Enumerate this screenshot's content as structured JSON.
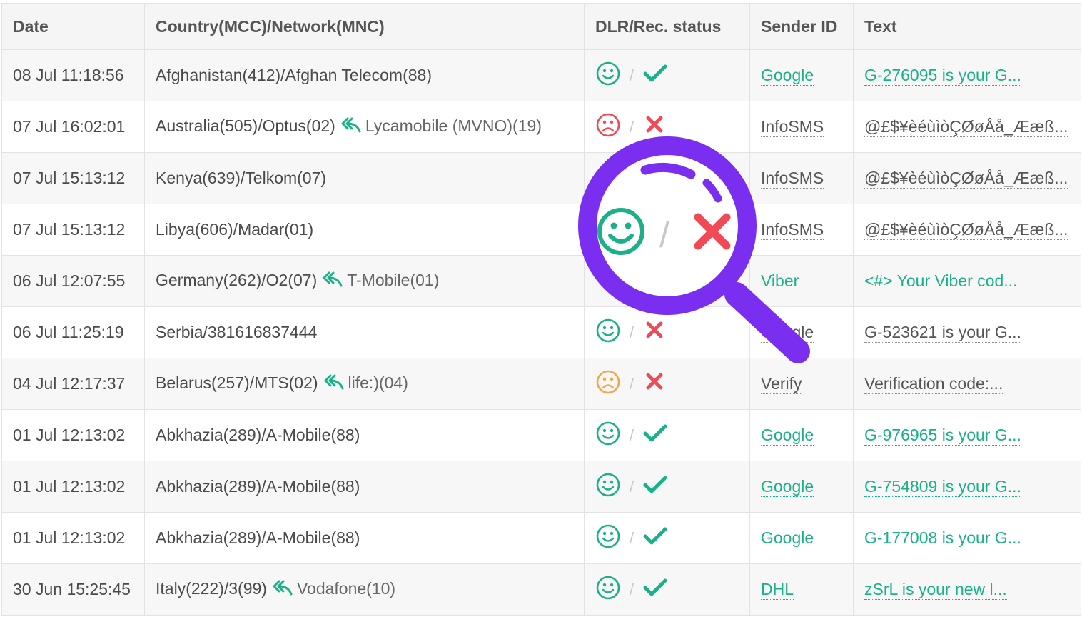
{
  "table": {
    "headers": [
      "Date",
      "Country(MCC)/Network(MNC)",
      "DLR/Rec. status",
      "Sender ID",
      "Text"
    ],
    "rows": [
      {
        "date": "08 Jul 11:18:56",
        "network": "Afghanistan(412)/Afghan Telecom(88)",
        "ported": "",
        "face": "happy",
        "check": "ok",
        "sender": "Google",
        "text": "G-276095 is your G...",
        "sender_link": true,
        "text_link": true
      },
      {
        "date": "07 Jul 16:02:01",
        "network": "Australia(505)/Optus(02)",
        "ported": "Lycamobile (MVNO)(19)",
        "face": "sad",
        "check": "fail",
        "sender": "InfoSMS",
        "text": "@£$¥èéùìòÇØøÅå_Ææß...",
        "sender_link": false,
        "text_link": false
      },
      {
        "date": "07 Jul 15:13:12",
        "network": "Kenya(639)/Telkom(07)",
        "ported": "",
        "face": "",
        "check": "",
        "sender": "InfoSMS",
        "text": "@£$¥èéùìòÇØøÅå_Ææß...",
        "sender_link": false,
        "text_link": false
      },
      {
        "date": "07 Jul 15:13:12",
        "network": "Libya(606)/Madar(01)",
        "ported": "",
        "face": "",
        "check": "",
        "sender": "InfoSMS",
        "text": "@£$¥èéùìòÇØøÅå_Ææß...",
        "sender_link": false,
        "text_link": false
      },
      {
        "date": "06 Jul 12:07:55",
        "network": "Germany(262)/O2(07)",
        "ported": "T-Mobile(01)",
        "face": "",
        "check": "",
        "sender": "Viber",
        "text": "<#> Your Viber cod...",
        "sender_link": true,
        "text_link": true
      },
      {
        "date": "06 Jul 11:25:19",
        "network": "Serbia/381616837444",
        "ported": "",
        "face": "happy",
        "check": "fail",
        "sender": "Google",
        "text": "G-523621 is your G...",
        "sender_link": false,
        "text_link": false
      },
      {
        "date": "04 Jul 12:17:37",
        "network": "Belarus(257)/MTS(02)",
        "ported": "life:)(04)",
        "face": "neutral",
        "check": "fail",
        "sender": "Verify",
        "text": "Verification code:...",
        "sender_link": false,
        "text_link": false
      },
      {
        "date": "01 Jul 12:13:02",
        "network": "Abkhazia(289)/A-Mobile(88)",
        "ported": "",
        "face": "happy",
        "check": "ok",
        "sender": "Google",
        "text": "G-976965 is your G...",
        "sender_link": true,
        "text_link": true
      },
      {
        "date": "01 Jul 12:13:02",
        "network": "Abkhazia(289)/A-Mobile(88)",
        "ported": "",
        "face": "happy",
        "check": "ok",
        "sender": "Google",
        "text": "G-754809 is your G...",
        "sender_link": true,
        "text_link": true
      },
      {
        "date": "01 Jul 12:13:02",
        "network": "Abkhazia(289)/A-Mobile(88)",
        "ported": "",
        "face": "happy",
        "check": "ok",
        "sender": "Google",
        "text": "G-177008 is your G...",
        "sender_link": true,
        "text_link": true
      },
      {
        "date": "30 Jun 15:25:45",
        "network": "Italy(222)/3(99)",
        "ported": "Vodafone(10)",
        "face": "happy",
        "check": "ok",
        "sender": "DHL",
        "text": "zSrL is your new l...",
        "sender_link": true,
        "text_link": true
      }
    ]
  },
  "magnifier": {
    "face": "happy",
    "check": "fail",
    "separator": "/"
  },
  "separator": "/",
  "colors": {
    "accent": "#1bb087",
    "fail": "#ef4b56",
    "neutral": "#f4a64a",
    "magnifier": "#7a2ff0"
  },
  "icons": {
    "ported": "reply-all-icon",
    "happy": "smiley-icon",
    "sad": "sad-face-icon",
    "ok": "checkmark-icon",
    "fail": "cross-icon"
  }
}
